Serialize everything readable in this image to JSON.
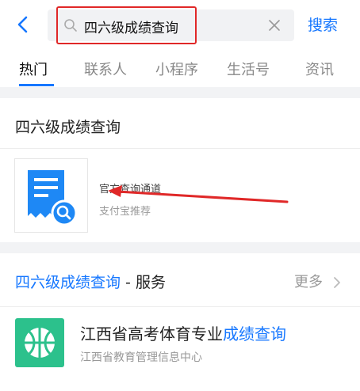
{
  "search": {
    "query": "四六级成绩查询",
    "submit_label": "搜索"
  },
  "tabs": [
    {
      "label": "热门",
      "active": true
    },
    {
      "label": "联系人"
    },
    {
      "label": "小程序"
    },
    {
      "label": "生活号"
    },
    {
      "label": "资讯"
    }
  ],
  "mini_app_card": {
    "title": "四六级成绩查询",
    "app_name": "官方查询通道",
    "app_subtitle": "支付宝推荐"
  },
  "service_card": {
    "title_highlight": "四六级成绩查询",
    "title_rest": " - 服务",
    "more_label": "更多",
    "item": {
      "name_plain": "江西省高考体育专业",
      "name_highlight": "成绩查询",
      "org": "江西省教育管理信息中心"
    }
  },
  "colors": {
    "accent": "#1677ff",
    "annotation_red": "#e02828",
    "service_icon_bg": "#2cc18c"
  },
  "icons": [
    "back-arrow-icon",
    "search-icon",
    "clear-icon",
    "certificate-search-icon",
    "chevron-right-icon",
    "basketball-icon"
  ]
}
